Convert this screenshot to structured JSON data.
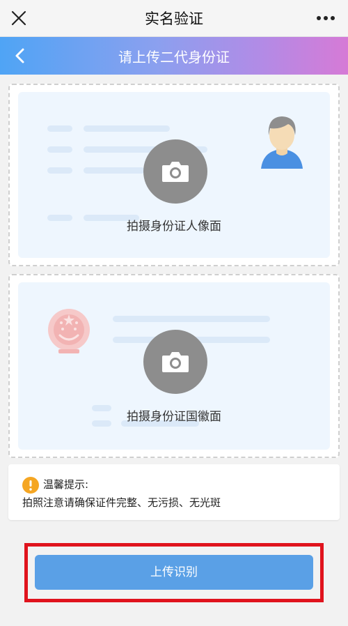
{
  "app_bar": {
    "title": "实名验证",
    "close_icon": "close-icon",
    "more_icon": "more-dots-icon"
  },
  "nav": {
    "title": "请上传二代身份证",
    "back_icon": "chevron-left-icon"
  },
  "front_card": {
    "caption": "拍摄身份证人像面",
    "camera_icon": "camera-icon",
    "illustration": "portrait-avatar-icon"
  },
  "back_card": {
    "caption": "拍摄身份证国徽面",
    "camera_icon": "camera-icon",
    "illustration": "national-emblem-icon"
  },
  "tip": {
    "title": "温馨提示:",
    "text": "拍照注意请确保证件完整、无污损、无光斑",
    "icon": "warning-icon"
  },
  "upload_button": {
    "label": "上传识别"
  },
  "colors": {
    "nav_gradient": [
      "#4fa4f5",
      "#d67ad6"
    ],
    "button": "#5aa0e6",
    "highlight_frame": "#e0131d"
  }
}
